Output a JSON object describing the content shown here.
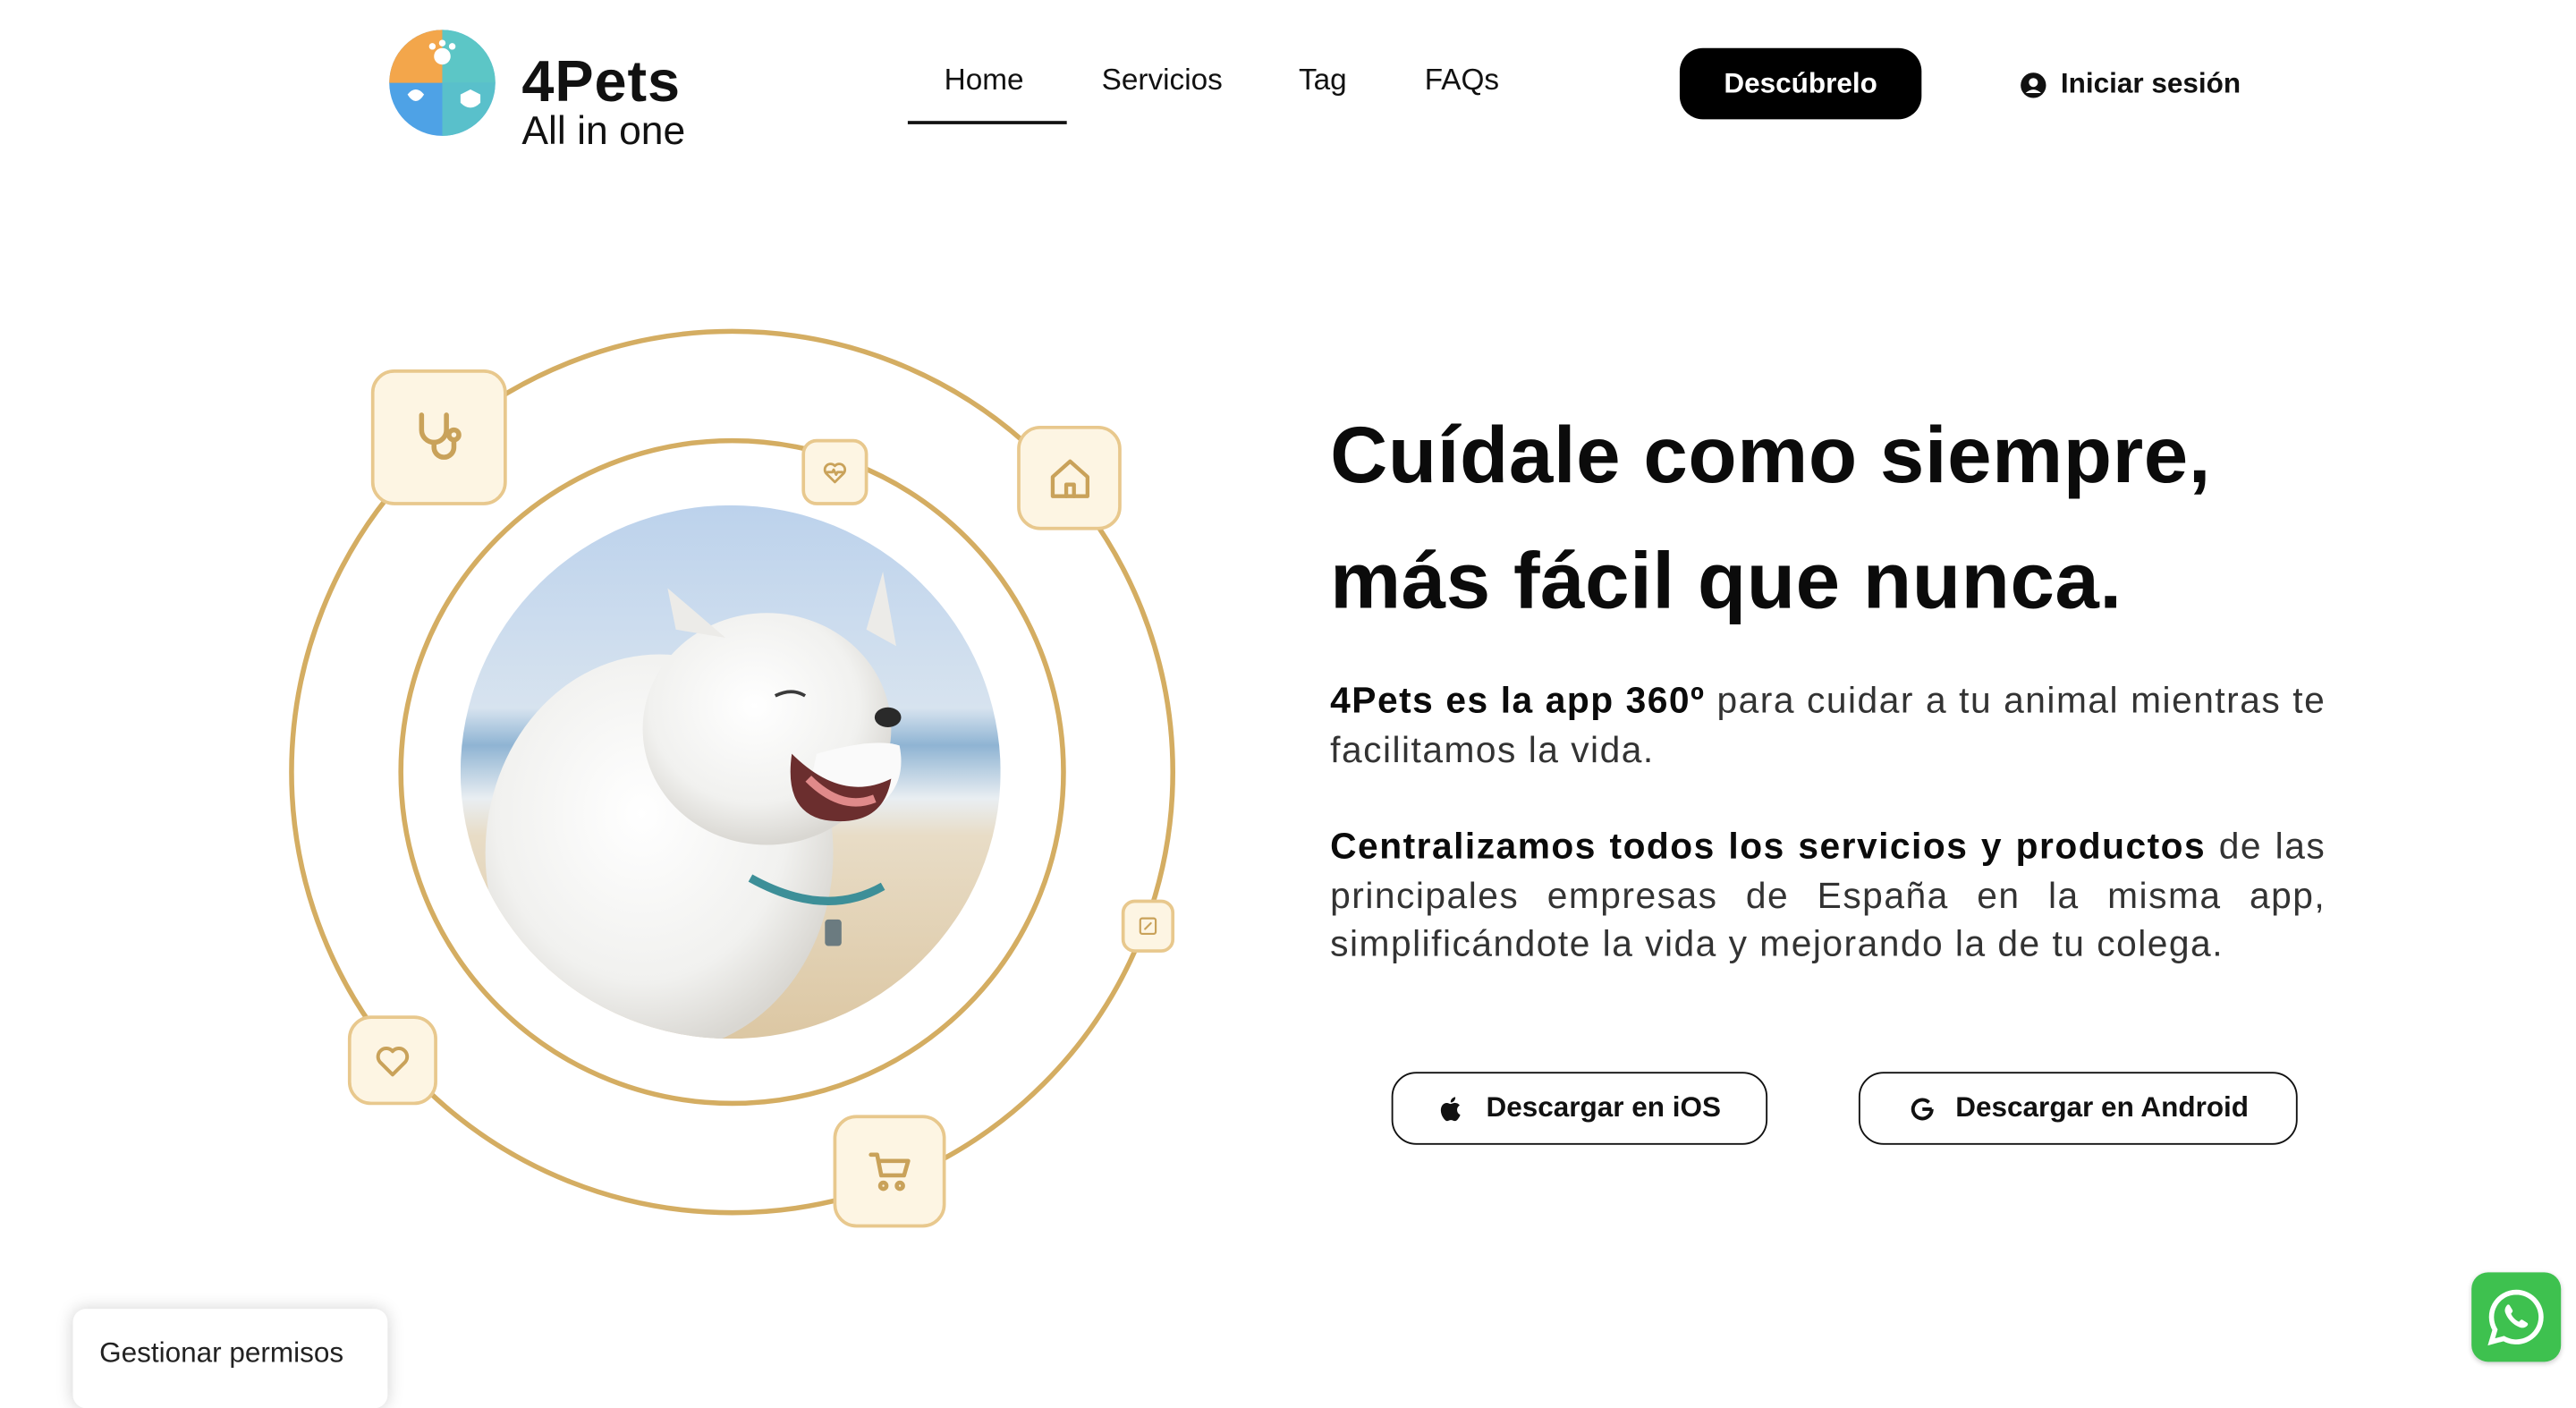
{
  "brand": {
    "name": "4Pets",
    "tagline": "All in one"
  },
  "nav": {
    "items": [
      {
        "label": "Home",
        "active": true
      },
      {
        "label": "Servicios"
      },
      {
        "label": "Tag"
      },
      {
        "label": "FAQs"
      }
    ],
    "cta_label": "Descúbrelo",
    "login_label": "Iniciar sesión"
  },
  "hero": {
    "headline_line1": "Cuídale como siempre,",
    "headline_line2": "más fácil que nunca.",
    "p1_bold": "4Pets es la app 360º",
    "p1_rest": " para cuidar a tu animal mientras te facilitamos la vida.",
    "p2_bold": "Centralizamos todos los servicios y productos",
    "p2_rest": " de las principales empresas de España en la misma app, simplificándote la vida y mejorando la de tu colega.",
    "ios_label": "Descargar en iOS",
    "android_label": "Descargar en Android"
  },
  "consent": {
    "label": "Gestionar permisos"
  },
  "icons": {
    "orbit": [
      "stethoscope-icon",
      "heart-pulse-icon",
      "home-icon",
      "document-icon",
      "cart-icon",
      "heart-icon"
    ],
    "login": "user-circle-icon",
    "ios": "apple-icon",
    "android": "google-icon",
    "chat": "whatsapp-icon"
  },
  "colors": {
    "accent_gold": "#d4ad62",
    "tile_bg": "#fdf5e3",
    "whatsapp": "#3ec14f",
    "logo_orange": "#f3a64b",
    "logo_teal": "#5cc6c6",
    "logo_blue": "#4ea2e6"
  }
}
